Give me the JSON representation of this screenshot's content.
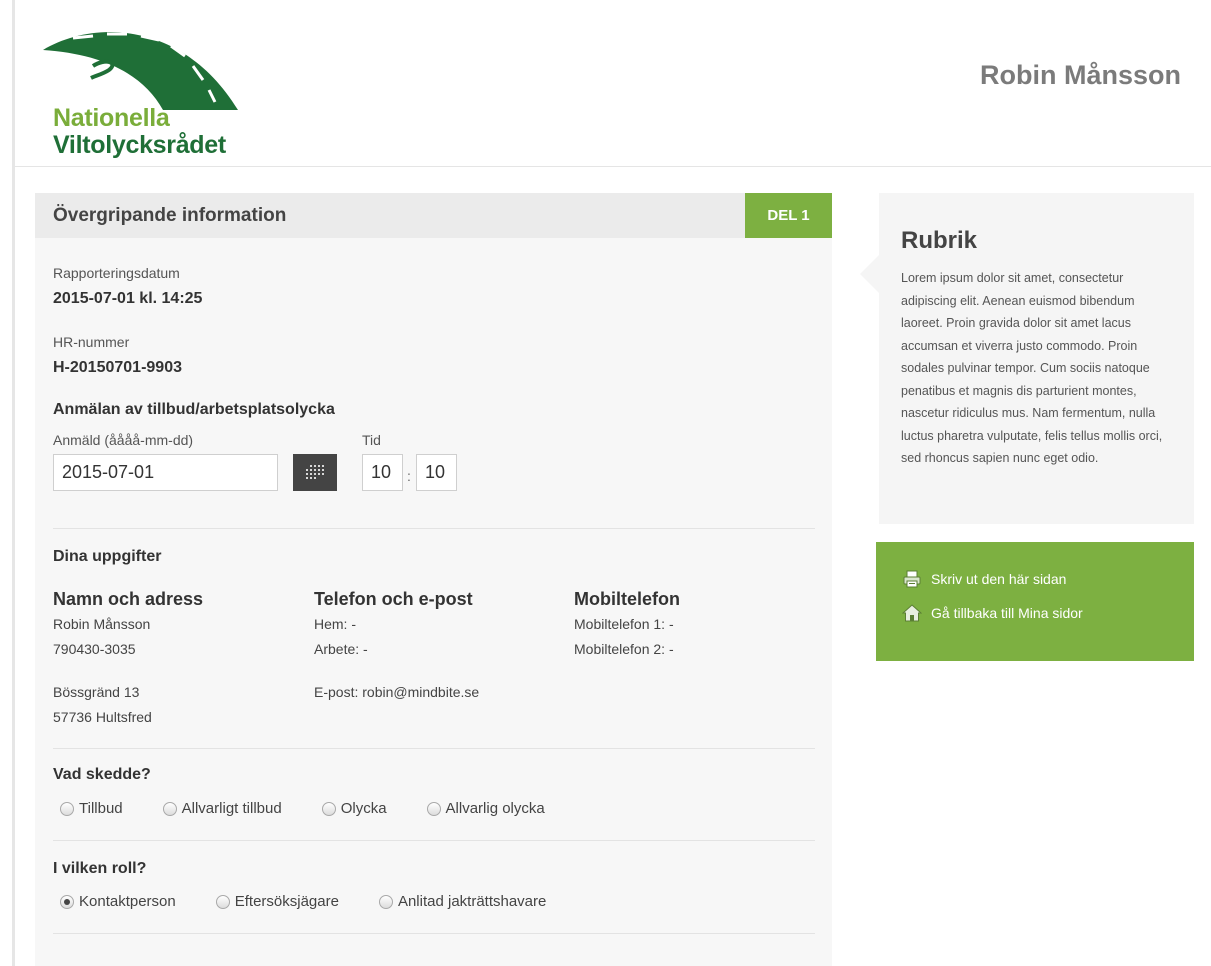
{
  "header": {
    "logo_line1": "Nationella",
    "logo_line2": "Viltolycksrådet",
    "user_name": "Robin Månsson"
  },
  "section": {
    "title": "Övergripande information",
    "badge": "DEL 1"
  },
  "report": {
    "date_label": "Rapporteringsdatum",
    "date_value": "2015-07-01 kl. 14:25",
    "hr_label": "HR-nummer",
    "hr_value": "H-20150701-9903"
  },
  "notice": {
    "heading": "Anmälan av tillbud/arbetsplatsolycka",
    "date_field_label": "Anmäld (åååå-mm-dd)",
    "date_field_value": "2015-07-01",
    "time_label": "Tid",
    "hour_value": "10",
    "time_separator": ":",
    "minute_value": "10"
  },
  "details": {
    "heading": "Dina uppgifter",
    "col1_heading": "Namn och adress",
    "name": "Robin Månsson",
    "personal_number": "790430-3035",
    "street": "Bössgränd 13",
    "postal": "57736 Hultsfred",
    "col2_heading": "Telefon och e-post",
    "home_phone": "Hem: -",
    "work_phone": "Arbete: -",
    "email": "E-post: robin@mindbite.se",
    "col3_heading": "Mobiltelefon",
    "mobile1": "Mobiltelefon 1: -",
    "mobile2": "Mobiltelefon 2: -"
  },
  "what_happened": {
    "heading": "Vad skedde?",
    "options": [
      "Tillbud",
      "Allvarligt tillbud",
      "Olycka",
      "Allvarlig olycka"
    ],
    "selected": ""
  },
  "role": {
    "heading": "I vilken roll?",
    "options": [
      "Kontaktperson",
      "Eftersöksjägare",
      "Anlitad jakträttshavare"
    ],
    "selected": "Kontaktperson"
  },
  "sidebar": {
    "info_title": "Rubrik",
    "info_body": "Lorem ipsum dolor sit amet, consectetur adipiscing elit. Aenean euismod bibendum laoreet. Proin gravida dolor sit amet lacus accumsan et viverra justo commodo. Proin sodales pulvinar tempor. Cum sociis natoque penatibus et magnis dis parturient montes, nascetur ridiculus mus. Nam fermentum, nulla luctus pharetra vulputate, felis tellus mollis orci, sed rhoncus sapien nunc eget odio.",
    "print_link": "Skriv ut den här sidan",
    "back_link": "Gå tillbaka till Mina sidor"
  },
  "colors": {
    "accent_green": "#7db041",
    "logo_dark_green": "#1f6f37",
    "logo_light_green": "#7aad3a"
  }
}
